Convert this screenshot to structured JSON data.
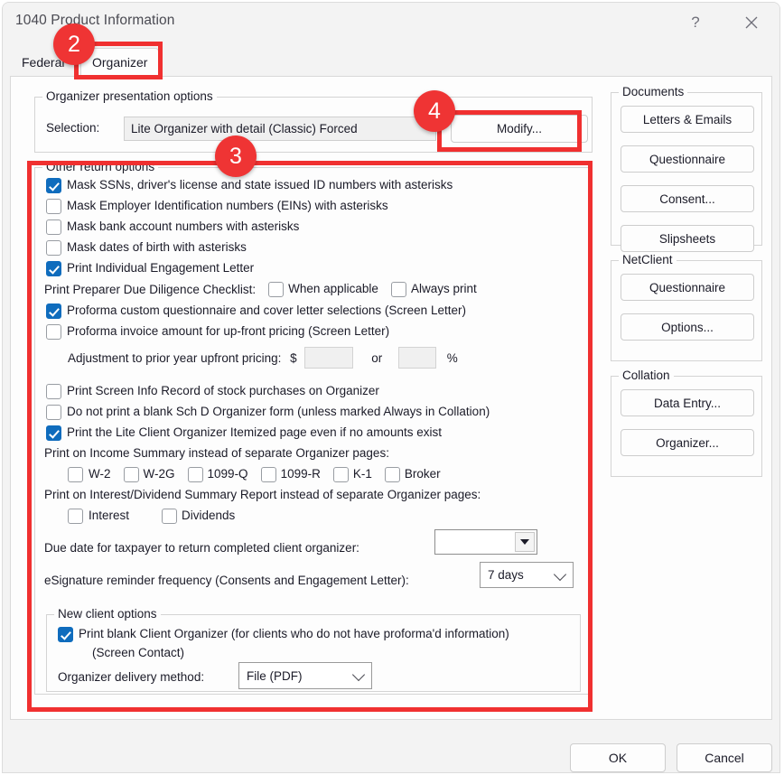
{
  "window": {
    "title": "1040 Product Information",
    "help_icon": "question-mark-icon",
    "close_icon": "close-icon"
  },
  "tabs": [
    {
      "id": "federal",
      "label": "Federal",
      "selected": false
    },
    {
      "id": "organizer",
      "label": "Organizer",
      "selected": true
    }
  ],
  "presentation_group": {
    "legend": "Organizer presentation options",
    "selection_label": "Selection:",
    "selection_value": "Lite Organizer with detail (Classic) Forced",
    "modify_label": "Modify..."
  },
  "other_group": {
    "legend": "Other return options",
    "checkboxes": [
      {
        "label": "Mask SSNs, driver's license and state issued ID numbers with asterisks",
        "checked": true
      },
      {
        "label": "Mask Employer Identification numbers (EINs) with asterisks",
        "checked": false
      },
      {
        "label": "Mask bank account numbers with asterisks",
        "checked": false
      },
      {
        "label": "Mask dates of birth with asterisks",
        "checked": false
      },
      {
        "label": "Print Individual Engagement Letter",
        "checked": true
      }
    ],
    "due_diligence": {
      "label": "Print Preparer Due Diligence Checklist:",
      "options": [
        {
          "label": "When applicable",
          "checked": false
        },
        {
          "label": "Always print",
          "checked": false
        }
      ]
    },
    "proforma_questionnaire": {
      "label": "Proforma custom questionnaire and cover letter selections (Screen Letter)",
      "checked": true
    },
    "proforma_invoice": {
      "label": "Proforma invoice amount for up-front pricing (Screen Letter)",
      "checked": false
    },
    "adjustment": {
      "label": "Adjustment to prior year upfront pricing:",
      "dollar_sign": "$",
      "dollar_value": "",
      "or_label": "or",
      "percent_value": "",
      "percent_sign": "%"
    },
    "checkboxes2": [
      {
        "label": "Print Screen Info Record of stock purchases on Organizer",
        "checked": false
      },
      {
        "label": "Do not print a blank Sch D Organizer form (unless marked Always in Collation)",
        "checked": false
      },
      {
        "label": "Print the Lite Client Organizer Itemized page even if no amounts exist",
        "checked": true
      }
    ],
    "income_summary": {
      "label": "Print on Income Summary instead of separate Organizer pages:",
      "options": [
        {
          "label": "W-2",
          "checked": false
        },
        {
          "label": "W-2G",
          "checked": false
        },
        {
          "label": "1099-Q",
          "checked": false
        },
        {
          "label": "1099-R",
          "checked": false
        },
        {
          "label": "K-1",
          "checked": false
        },
        {
          "label": "Broker",
          "checked": false
        }
      ]
    },
    "interest_dividend": {
      "label": "Print on Interest/Dividend Summary Report instead of separate Organizer pages:",
      "options": [
        {
          "label": "Interest",
          "checked": false
        },
        {
          "label": "Dividends",
          "checked": false
        }
      ]
    },
    "due_date": {
      "label": "Due date for taxpayer to return completed client organizer:",
      "value": "",
      "dropdown_icon": "chevron-down-icon"
    },
    "esignature": {
      "label": "eSignature reminder frequency (Consents and Engagement Letter):",
      "value": "7 days",
      "dropdown_icon": "chevron-down-icon"
    }
  },
  "new_client_group": {
    "legend": "New client options",
    "print_blank": {
      "label": "Print blank Client Organizer (for clients who do not have proforma'd information)",
      "label_line2": "(Screen Contact)",
      "checked": true
    },
    "delivery": {
      "label": "Organizer delivery method:",
      "value": "File (PDF)",
      "dropdown_icon": "chevron-down-icon"
    }
  },
  "side_panel": {
    "documents": {
      "legend": "Documents",
      "buttons": [
        "Letters & Emails",
        "Questionnaire",
        "Consent...",
        "Slipsheets"
      ]
    },
    "netclient": {
      "legend": "NetClient",
      "buttons": [
        "Questionnaire",
        "Options..."
      ]
    },
    "collation": {
      "legend": "Collation",
      "buttons": [
        "Data Entry...",
        "Organizer..."
      ]
    }
  },
  "footer": {
    "ok_label": "OK",
    "cancel_label": "Cancel"
  },
  "annotations": {
    "color": "#ef3434",
    "badges": [
      {
        "number": "2",
        "target": "organizer-tab"
      },
      {
        "number": "3",
        "target": "other-return-options-group"
      },
      {
        "number": "4",
        "target": "modify-button"
      }
    ]
  }
}
